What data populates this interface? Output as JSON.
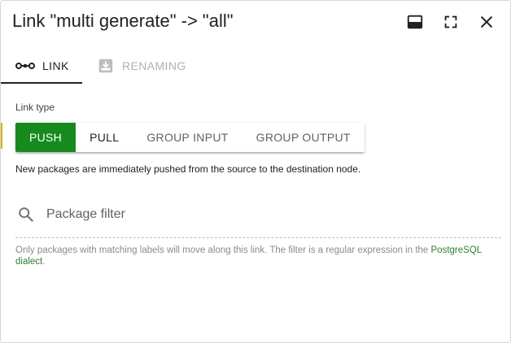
{
  "dialog": {
    "title": "Link \"multi generate\" -> \"all\"",
    "buttons": {
      "dock_icon": "dock-bottom-icon",
      "fullscreen_icon": "fullscreen-icon",
      "close_icon": "close-icon"
    }
  },
  "tabs": [
    {
      "label": "LINK",
      "icon": "link-icon",
      "active": true
    },
    {
      "label": "RENAMING",
      "icon": "rename-icon",
      "active": false
    }
  ],
  "link_type": {
    "label": "Link type",
    "options": [
      "PUSH",
      "PULL",
      "GROUP INPUT",
      "GROUP OUTPUT"
    ],
    "selected": "PUSH",
    "description": "New packages are immediately pushed from the source to the destination node."
  },
  "filter": {
    "placeholder": "Package filter",
    "value": "",
    "hint_text": "Only packages with matching labels will move along this link. The filter is a regular expression in the ",
    "hint_link": "PostgreSQL dialect",
    "hint_end": "."
  },
  "colors": {
    "accent_green": "#168a1e",
    "link_green": "#2e7d32"
  }
}
